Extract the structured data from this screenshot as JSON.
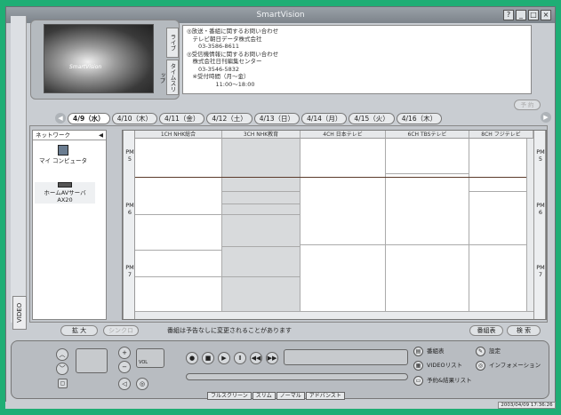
{
  "window": {
    "title": "SmartVision",
    "buttons": [
      "?",
      "_",
      "□",
      "×"
    ]
  },
  "left_strip": {
    "video_tab": "VIDEO"
  },
  "preview": {
    "logo": "SmartVision",
    "tab_live": "ライブ",
    "tab_timeslip": "タイムスリップ"
  },
  "info_box": {
    "lines": [
      "◎放送・番組に関するお問い合わせ",
      "　テレビ朝日データ株式会社",
      "　　03-3586-8611",
      "◎受信機情報に関するお問い合わせ",
      "　株式会社日刊編集センター",
      "　　03-3546-5832",
      "　※受付時間（月〜金）",
      "　　　　　11:00〜18:00"
    ]
  },
  "reserve_button": "予 約",
  "dates": [
    "4/9（水）",
    "4/10（木）",
    "4/11（金）",
    "4/12（土）",
    "4/13（日）",
    "4/14（月）",
    "4/15（火）",
    "4/16（木）"
  ],
  "active_date_index": 0,
  "network": {
    "header": "ネットワーク",
    "devices": [
      {
        "name": "マイ コンピュータ",
        "icon": "computer-icon"
      },
      {
        "name": "ホームAVサーバ\nAX20",
        "icon": "server-icon"
      }
    ]
  },
  "guide": {
    "channels": [
      "1CH NHK総合",
      "3CH NHK教育",
      "4CH 日本テレビ",
      "6CH TBSテレビ",
      "8CH フジテレビ"
    ],
    "time_labels": [
      {
        "period": "PM",
        "hour": "5"
      },
      {
        "period": "PM",
        "hour": "6"
      },
      {
        "period": "PM",
        "hour": "7"
      }
    ],
    "channel_colors": {
      "gray": "#d8dadc",
      "white": "#ffffff"
    }
  },
  "bottom_bar": {
    "zoom": "拡 大",
    "sync": "シンクロ",
    "notice": "番組は予告なしに変更されることがあります",
    "guide_button": "番組表",
    "search_button": "検 索"
  },
  "controls": {
    "vol_label": "VOL",
    "menu": [
      {
        "label": "番組表",
        "icon": "guide-icon"
      },
      {
        "label": "設定",
        "icon": "settings-icon"
      },
      {
        "label": "VIDEOリスト",
        "icon": "video-list-icon"
      },
      {
        "label": "インフォメーション",
        "icon": "info-icon"
      },
      {
        "label": "予約&結果リスト",
        "icon": "reserve-list-icon"
      }
    ],
    "modes": [
      "フルスクリーン",
      "スリム",
      "ノーマル",
      "アドバンスト"
    ]
  },
  "status": {
    "clock": "2003/04/09 17:36:26"
  }
}
